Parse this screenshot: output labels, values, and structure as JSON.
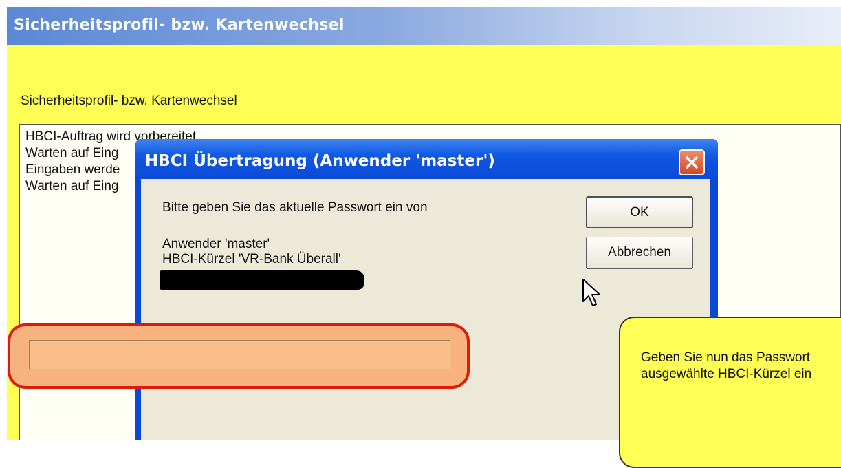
{
  "outer_window": {
    "title": "Sicherheitsprofil- bzw. Kartenwechsel",
    "heading": "Sicherheitsprofil- bzw. Kartenwechsel",
    "log_lines": [
      "HBCI-Auftrag wird vorbereitet",
      "Warten auf Eing",
      "Eingaben werde",
      "Warten auf Eing"
    ]
  },
  "dialog": {
    "title": "HBCI Übertragung (Anwender 'master')",
    "close_icon": "close-icon",
    "prompt": "Bitte geben Sie das aktuelle Passwort ein von",
    "user_line": "Anwender 'master'",
    "hbci_line": "HBCI-Kürzel 'VR-Bank Überall'",
    "ok_label": "OK",
    "cancel_label": "Abbrechen",
    "password_value": ""
  },
  "help": {
    "line1": "Geben Sie nun das Passwort",
    "line2": "ausgewählte HBCI-Kürzel ein"
  },
  "colors": {
    "background_yellow": "#ffff55",
    "dialog_blue": "#0a49d6",
    "highlight_red": "#e01a0a",
    "highlight_fill": "#f6b380"
  }
}
